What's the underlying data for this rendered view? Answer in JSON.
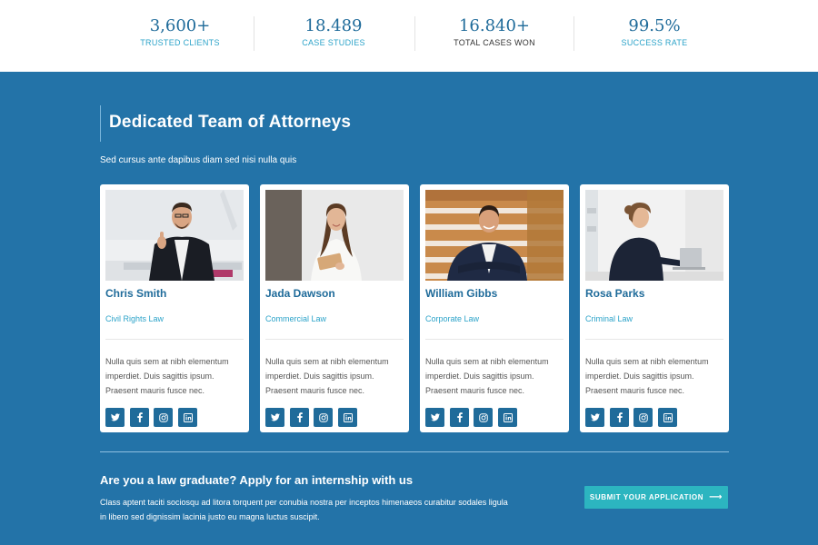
{
  "stats": [
    {
      "value": "3,600+",
      "label": "TRUSTED CLIENTS"
    },
    {
      "value": "18.489",
      "label": "CASE STUDIES"
    },
    {
      "value": "16.840+",
      "label": "TOTAL CASES WON"
    },
    {
      "value": "99.5%",
      "label": "SUCCESS RATE"
    }
  ],
  "section": {
    "title": "Dedicated Team of Attorneys",
    "subtitle": "Sed cursus ante dapibus diam sed nisi nulla quis"
  },
  "attorneys": [
    {
      "name": "Chris Smith",
      "practice": "Civil Rights Law",
      "bio": "Nulla quis sem at nibh elementum imperdiet. Duis sagittis ipsum. Praesent mauris fusce nec."
    },
    {
      "name": "Jada Dawson",
      "practice": "Commercial Law",
      "bio": "Nulla quis sem at nibh elementum imperdiet. Duis sagittis ipsum. Praesent mauris fusce nec."
    },
    {
      "name": "William Gibbs",
      "practice": "Corporate Law",
      "bio": "Nulla quis sem at nibh elementum imperdiet. Duis sagittis ipsum. Praesent mauris fusce nec."
    },
    {
      "name": "Rosa Parks",
      "practice": "Criminal Law",
      "bio": "Nulla quis sem at nibh elementum imperdiet. Duis sagittis ipsum. Praesent mauris fusce nec."
    }
  ],
  "social_icons": [
    "twitter-icon",
    "facebook-icon",
    "instagram-icon",
    "linkedin-icon"
  ],
  "internship": {
    "title": "Are you a law graduate? Apply for an internship with us",
    "text": "Class aptent taciti sociosqu ad litora torquent per conubia nostra per inceptos himenaeos curabitur sodales ligula in libero sed dignissim lacinia justo eu magna luctus suscipit.",
    "button_label": "SUBMIT YOUR APPLICATION",
    "button_arrow": "⟶"
  },
  "colors": {
    "section_bg": "#2373a8",
    "primary": "#1f6b9a",
    "accent": "#2ca3c9",
    "button": "#2cb5c0"
  }
}
